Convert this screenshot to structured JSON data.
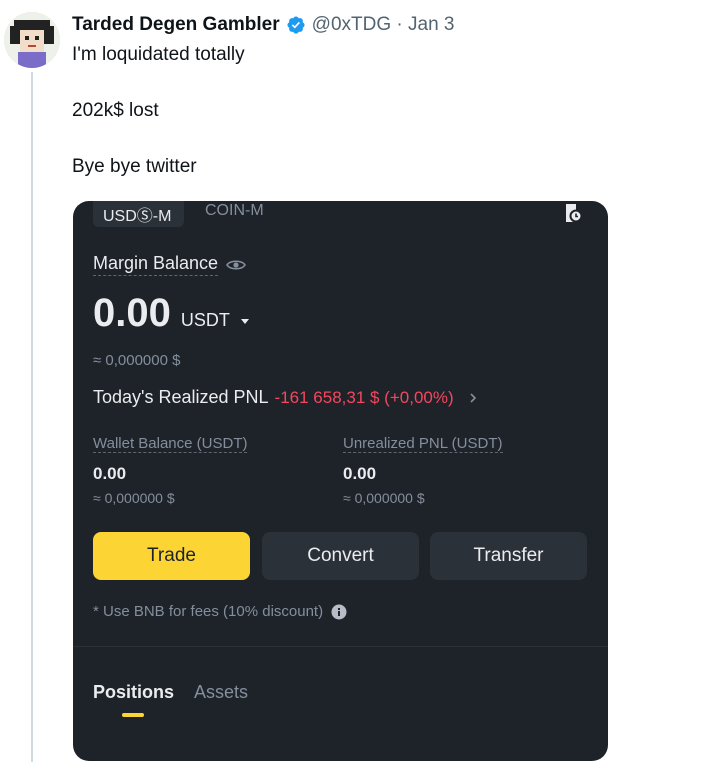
{
  "tweet": {
    "display_name": "Tarded Degen Gambler",
    "handle_date": "@0xTDG · Jan 3",
    "lines": [
      "I'm loquidated totally",
      "202k$ lost",
      "Bye bye twitter"
    ],
    "avatar_icon": "pixel-art-avatar",
    "verified_icon": "verified-badge-icon",
    "colors": {
      "verified": "#1d9bf0",
      "text": "#0f1419",
      "muted": "#536471"
    }
  },
  "app": {
    "tabs": [
      "USDⓈ-M",
      "COIN-M"
    ],
    "margin_label": "Margin Balance",
    "balance": "0.00",
    "balance_currency": "USDT",
    "balance_approx": "≈ 0,000000 $",
    "pnl_label": "Today's Realized PNL",
    "pnl_value": "-161 658,31 $ (+0,00%)",
    "wallet": {
      "label": "Wallet Balance (USDT)",
      "value": "0.00",
      "approx": "≈ 0,000000 $"
    },
    "unrealized": {
      "label": "Unrealized PNL (USDT)",
      "value": "0.00",
      "approx": "≈ 0,000000 $"
    },
    "buttons": {
      "trade": "Trade",
      "convert": "Convert",
      "transfer": "Transfer"
    },
    "bnb_note": "* Use BNB for fees (10% discount)",
    "bottom_tabs": {
      "positions": "Positions",
      "assets": "Assets"
    },
    "colors": {
      "bg": "#1e2329",
      "accent": "#fcd535",
      "negative": "#f6465d",
      "button_dark": "#2b3139"
    }
  }
}
